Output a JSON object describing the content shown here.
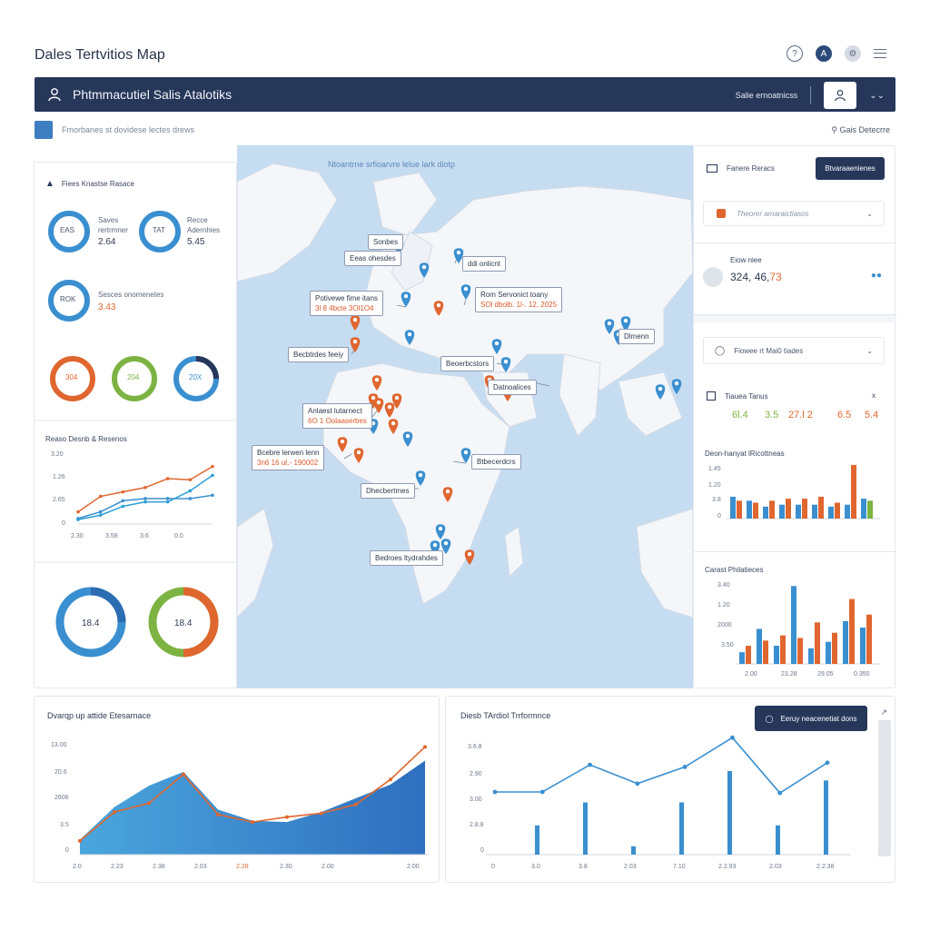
{
  "app": {
    "title": "Dales Tertvitios Map",
    "brand": "Phtmmacutiel Salis Atalotiks",
    "nav_link": "Salie ernoatnicss",
    "breadcrumb": "Fmorbanes st dovidese lectes drews",
    "search_label": "Gais Detecrre"
  },
  "icons": {
    "top": [
      "help-icon",
      "account-icon",
      "settings-icon",
      "menu-icon"
    ],
    "nav_user": "user-icon"
  },
  "colors": {
    "navy": "#26375a",
    "blue": "#3a8fd0",
    "orange": "#e0662f",
    "green": "#7cb342",
    "map_water": "#c6dcf1",
    "map_land": "#f4f6f9"
  },
  "left_panel": {
    "header": "Fiees Knastse Rasace",
    "rings": [
      {
        "label": "Saves\nrertrmner",
        "center": "EAS",
        "value": "2.64"
      },
      {
        "label": "Recce\nAdernhies",
        "center": "TAT",
        "value": "5.45"
      },
      {
        "label": "Sesces onomenetes",
        "center": "ROK",
        "value": "3.43"
      }
    ],
    "rings_row2": [
      "304",
      "204",
      "20X"
    ],
    "line_title": "Reaso Desnb & Resenos",
    "line_ticks_y": [
      "3.20",
      "1.26",
      "2.65",
      "0"
    ],
    "line_ticks_x": [
      "2.30",
      "3.58",
      "3.6",
      "0.0"
    ],
    "donut_vals": [
      "18.4",
      "18.4"
    ]
  },
  "map": {
    "title": "Ntoantrne srfioarvre lelue lark diotp",
    "callouts": [
      {
        "text": "Sonbes"
      },
      {
        "text": "Eeas ohesdes"
      },
      {
        "text": "ddi onlicnt"
      },
      {
        "text": "Potivewe fime itans",
        "sub": "3l 8 4bcte 3Ol1O4"
      },
      {
        "text": "Rom Servonict toany",
        "sub": "SOl dbolb. 1l-. 12, 2025"
      },
      {
        "text": "Becbtrdes feeiy"
      },
      {
        "text": "Beoerbcstors"
      },
      {
        "text": "Datnoalices"
      },
      {
        "text": "Anlaest lutarnect",
        "sub": "6O 1 Oolaaserbes"
      },
      {
        "text": "Bcebre lerwen lenn",
        "sub": "3n6 16 ut.- 190002"
      },
      {
        "text": "Btbecerdcrs"
      },
      {
        "text": "Dhecbertmes"
      },
      {
        "text": "Bedroes ltydrahdes"
      },
      {
        "text": "Dlmenn"
      }
    ]
  },
  "right_panel": {
    "filter_label": "Fanere Reracs",
    "filter_btn": "Btvaraaenienes",
    "dropdown1": "Theorer amaraictiasos",
    "kpi_label": "Eiow niee",
    "kpi_value": "324, 46,",
    "kpi_value_red": "73",
    "dropdown2": "Fiowee rt Mai0 tiades",
    "tasks_title": "Tiauea Tanus",
    "tasks_close": "x",
    "mini_kpis": [
      "6l.4",
      "3.5",
      "27.l 2",
      "6.5",
      "5.4"
    ],
    "bar1_title": "Deon-hanyat lRicottneas",
    "bar1_y": [
      "1.45",
      "1.20",
      "3.8",
      "0"
    ],
    "bar2_title": "Carast Philatieces",
    "bar2_y": [
      "3.40",
      "1.20",
      "2000",
      "3.50"
    ],
    "bar2_x": [
      "2.00",
      "23.28",
      "29.05",
      "0.350"
    ]
  },
  "bottom_left": {
    "title": "Dvarqp up attide Etesarnace",
    "y_ticks": [
      "13.00",
      "20.6",
      "2606",
      "3.5",
      "0"
    ],
    "x_ticks": [
      "2.0",
      "2.23",
      "2.38",
      "2.03",
      "2.28",
      "2.30",
      "2.00",
      "2.00"
    ]
  },
  "bottom_right": {
    "title": "Diesb TArdiol Trrformnce",
    "btn": "Eeruy neacenetiat dons",
    "y_ticks": [
      "3.6.8",
      "2.90",
      "3.00",
      "2.8.8",
      "0"
    ],
    "x_ticks": [
      "0",
      "3.0",
      "3.8",
      "2.03",
      "7.10",
      "2.2.93",
      "2.03",
      "2.2.38"
    ]
  },
  "chart_data": [
    {
      "type": "line",
      "title": "Reaso Desnb & Resenos",
      "x": [
        0,
        1,
        2,
        3,
        4,
        5,
        6
      ],
      "series": [
        {
          "values": [
            0.55,
            1.25,
            1.45,
            1.65,
            2.05,
            2.0,
            2.6
          ]
        },
        {
          "values": [
            0.25,
            0.55,
            1.05,
            1.15,
            1.15,
            1.15,
            1.3
          ]
        },
        {
          "values": [
            0.2,
            0.4,
            0.8,
            1.0,
            1.0,
            1.5,
            2.2
          ]
        }
      ],
      "ylim": [
        0,
        3.2
      ]
    },
    {
      "type": "bar",
      "title": "Deon-hanyat lRicottneas",
      "series": [
        {
          "values": [
            0.55,
            0.45,
            0.3,
            0.35,
            0.35,
            0.35,
            0.3,
            0.35,
            0.5
          ]
        },
        {
          "values": [
            0.45,
            0.4,
            0.45,
            0.5,
            0.5,
            0.55,
            0.4,
            1.35,
            0.45
          ]
        }
      ],
      "ylim": [
        0,
        1.6
      ]
    },
    {
      "type": "bar",
      "title": "Carast Philatieces",
      "series": [
        {
          "values": [
            450,
            1350,
            700,
            3000,
            600,
            850,
            1650,
            1400
          ]
        },
        {
          "values": [
            700,
            900,
            1100,
            1000,
            1600,
            1200,
            2500,
            1900
          ]
        }
      ],
      "ylim": [
        0,
        3500
      ]
    },
    {
      "type": "area",
      "title": "Dvarqp up attide Etesarnace",
      "series": [
        {
          "values": [
            1.2,
            3.8,
            5.5,
            6.6,
            3.6,
            2.7,
            2.6,
            3.4,
            4.5,
            5.6,
            7.5
          ]
        },
        {
          "values": [
            1.1,
            3.4,
            4.1,
            6.4,
            3.2,
            2.6,
            3.0,
            3.3,
            4.0,
            6.0,
            8.6
          ]
        }
      ],
      "ylim": [
        0,
        10
      ]
    },
    {
      "type": "line",
      "title": "Diesb TArdiol Trrformnce",
      "series": [
        {
          "values": [
            3.0,
            3.0,
            4.3,
            3.4,
            4.2,
            5.6,
            2.95,
            4.4
          ]
        },
        {
          "values": [
            1.4,
            2.5,
            0.4,
            2.5,
            4.0,
            1.4,
            3.55
          ]
        }
      ],
      "ylim": [
        0,
        6
      ]
    }
  ]
}
